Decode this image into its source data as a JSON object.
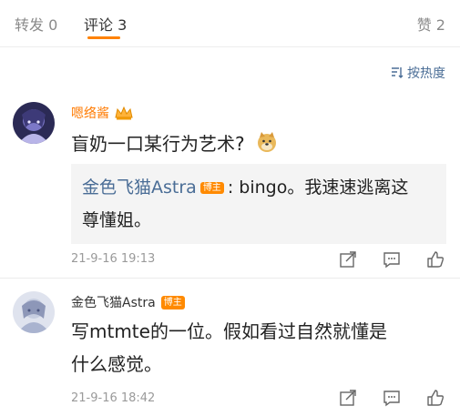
{
  "tabs": [
    {
      "label": "转发 0"
    },
    {
      "label": "评论 3"
    },
    {
      "label": "赞 2"
    }
  ],
  "sort": {
    "label": "按热度"
  },
  "comments": [
    {
      "username": "嗯络酱",
      "text": "盲奶一口某行为艺术?",
      "reply": {
        "username": "金色飞猫Astra",
        "badge": "博主",
        "text_line1": ": bingo。我速速逃离这",
        "text_line2": "尊懂姐。"
      },
      "time": "21-9-16 19:13"
    },
    {
      "username": "金色飞猫Astra",
      "badge": "博主",
      "text_line1": "写mtmte的一位。假如看过自然就懂是",
      "text_line2": "什么感觉。",
      "time": "21-9-16 18:42"
    }
  ],
  "colors": {
    "accent": "#ff8200",
    "link": "#4a6d96",
    "username_highlight": "#ff7a00"
  }
}
